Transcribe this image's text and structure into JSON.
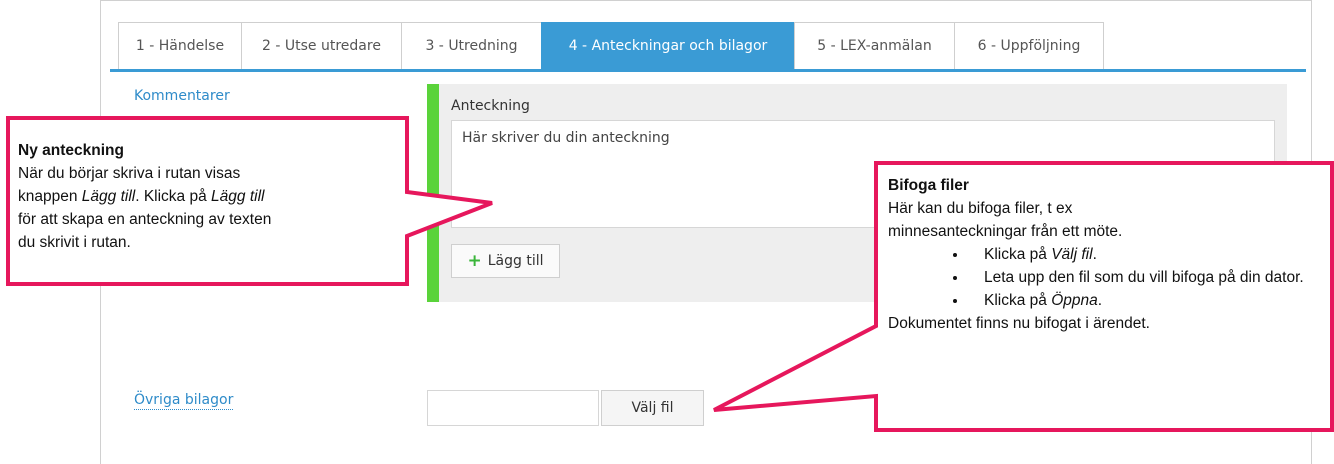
{
  "tabs": [
    {
      "label": "1 - Händelse",
      "active": false
    },
    {
      "label": "2 - Utse utredare",
      "active": false
    },
    {
      "label": "3 - Utredning",
      "active": false
    },
    {
      "label": "4 - Anteckningar och bilagor",
      "active": true
    },
    {
      "label": "5 - LEX-anmälan",
      "active": false
    },
    {
      "label": "6 - Uppföljning",
      "active": false
    }
  ],
  "sections": {
    "comments_link": "Kommentarer",
    "attachments_link": "Övriga bilagor"
  },
  "note": {
    "label": "Anteckning",
    "placeholder": "Här skriver du din anteckning",
    "add_button": "Lägg till"
  },
  "file": {
    "choose_button": "Välj fil",
    "value": ""
  },
  "callout_left": {
    "title": "Ny anteckning",
    "line1": "När du börjar skriva i rutan visas",
    "line2_pre": "knappen ",
    "line2_em1": "Lägg till",
    "line2_mid": ". Klicka på ",
    "line2_em2": "Lägg till",
    "line3": "för att skapa en anteckning av texten",
    "line4": "du skrivit i rutan."
  },
  "callout_right": {
    "title": "Bifoga filer",
    "line1": "Här kan du bifoga filer, t ex",
    "line2": "minnesanteckningar från ett möte.",
    "b1_pre": "Klicka på ",
    "b1_em": "Välj fil",
    "b1_post": ".",
    "b2": "Leta upp den fil som du vill bifoga på din dator.",
    "b3_pre": "Klicka på ",
    "b3_em": "Öppna",
    "b3_post": ".",
    "footer": "Dokumentet finns nu bifogat i ärendet."
  },
  "colors": {
    "accent": "#3a9bd5",
    "callout_border": "#e6175c",
    "note_bar": "#5ad33a"
  }
}
